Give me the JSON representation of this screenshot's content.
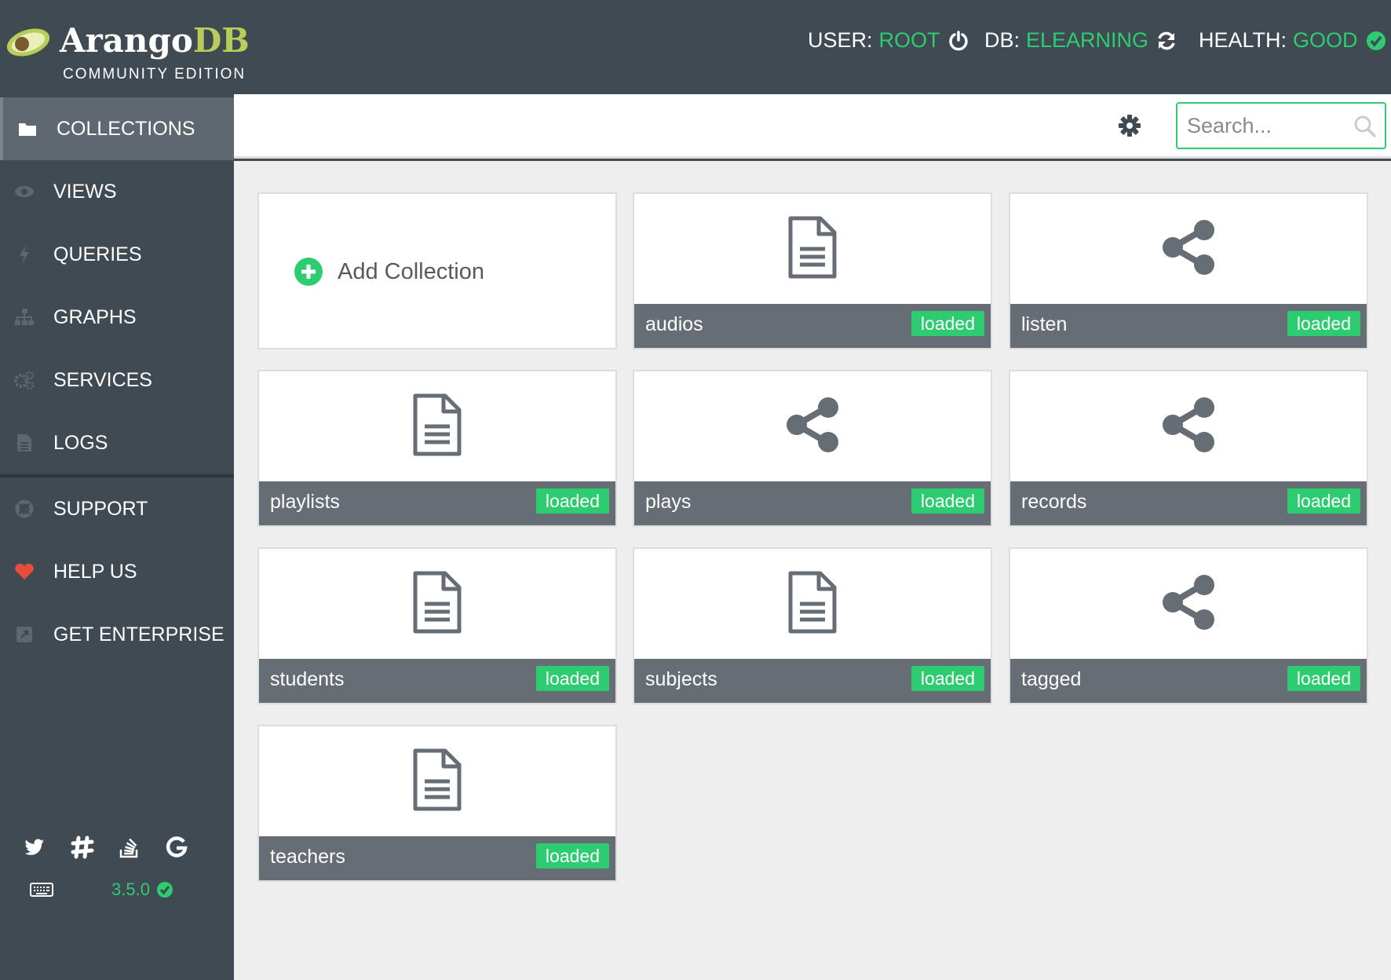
{
  "header": {
    "brand_main": "Arango",
    "brand_db": "DB",
    "edition": "COMMUNITY EDITION",
    "user_label": "USER:",
    "user_value": "ROOT",
    "db_label": "DB:",
    "db_value": "ELEARNING",
    "health_label": "HEALTH:",
    "health_value": "GOOD"
  },
  "sidebar": {
    "items": [
      {
        "label": "COLLECTIONS",
        "icon": "folder-icon",
        "active": true
      },
      {
        "label": "VIEWS",
        "icon": "eye-icon",
        "active": false
      },
      {
        "label": "QUERIES",
        "icon": "bolt-icon",
        "active": false
      },
      {
        "label": "GRAPHS",
        "icon": "sitemap-icon",
        "active": false
      },
      {
        "label": "SERVICES",
        "icon": "cogs-icon",
        "active": false
      },
      {
        "label": "LOGS",
        "icon": "file-icon",
        "active": false
      },
      {
        "label": "SUPPORT",
        "icon": "lifebuoy-icon",
        "active": false
      },
      {
        "label": "HELP US",
        "icon": "heart-icon",
        "active": false
      },
      {
        "label": "GET ENTERPRISE",
        "icon": "external-link-icon",
        "active": false
      }
    ],
    "version": "3.5.0",
    "social": [
      "twitter-icon",
      "slack-icon",
      "stackoverflow-icon",
      "google-icon"
    ]
  },
  "toolbar": {
    "search_placeholder": "Search..."
  },
  "collections": {
    "add_label": "Add Collection",
    "items": [
      {
        "name": "audios",
        "type": "document",
        "status": "loaded"
      },
      {
        "name": "listen",
        "type": "edge",
        "status": "loaded"
      },
      {
        "name": "playlists",
        "type": "document",
        "status": "loaded"
      },
      {
        "name": "plays",
        "type": "edge",
        "status": "loaded"
      },
      {
        "name": "records",
        "type": "edge",
        "status": "loaded"
      },
      {
        "name": "students",
        "type": "document",
        "status": "loaded"
      },
      {
        "name": "subjects",
        "type": "document",
        "status": "loaded"
      },
      {
        "name": "tagged",
        "type": "edge",
        "status": "loaded"
      },
      {
        "name": "teachers",
        "type": "document",
        "status": "loaded"
      }
    ]
  },
  "colors": {
    "accent": "#2ecc71",
    "header_bg": "#404a53",
    "brand_db": "#b8cc5a",
    "heart": "#e74c3c"
  }
}
